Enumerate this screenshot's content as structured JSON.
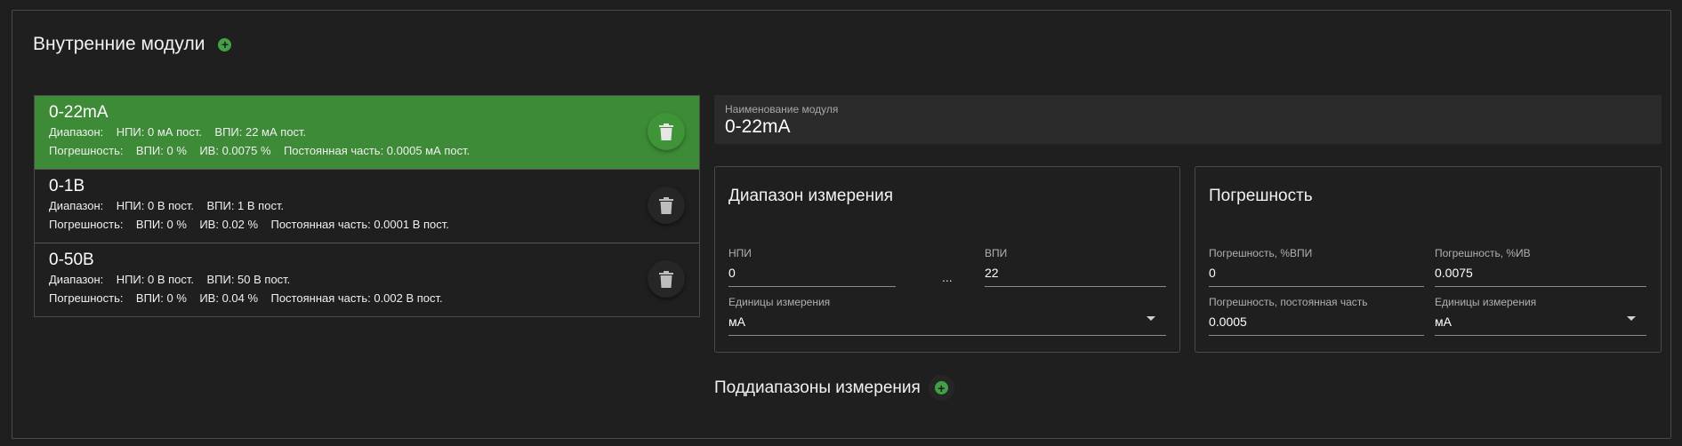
{
  "header": {
    "title": "Внутренние модули"
  },
  "modules": [
    {
      "name": "0-22mA",
      "range_line": "Диапазон:    НПИ: 0 мА пост.    ВПИ: 22 мА пост.",
      "error_line": "Погрешность:    ВПИ: 0 %    ИВ: 0.0075 %    Постоянная часть: 0.0005 мА пост."
    },
    {
      "name": "0-1В",
      "range_line": "Диапазон:    НПИ: 0 В пост.    ВПИ: 1 В пост.",
      "error_line": "Погрешность:    ВПИ: 0 %    ИВ: 0.02 %    Постоянная часть: 0.0001 В пост."
    },
    {
      "name": "0-50В",
      "range_line": "Диапазон:    НПИ: 0 В пост.    ВПИ: 50 В пост.",
      "error_line": "Погрешность:    ВПИ: 0 %    ИВ: 0.04 %    Постоянная часть: 0.002 В пост."
    }
  ],
  "module_name_field": {
    "label": "Наименование модуля",
    "value": "0-22mA"
  },
  "range_card": {
    "title": "Диапазон измерения",
    "npi_label": "НПИ",
    "npi_value": "0",
    "separator": "...",
    "vpi_label": "ВПИ",
    "vpi_value": "22",
    "units_label": "Единицы измерения",
    "units_value": "мА"
  },
  "error_card": {
    "title": "Погрешность",
    "vpi_pct_label": "Погрешность, %ВПИ",
    "vpi_pct_value": "0",
    "iv_pct_label": "Погрешность, %ИВ",
    "iv_pct_value": "0.0075",
    "const_label": "Погрешность, постоянная часть",
    "const_value": "0.0005",
    "units_label": "Единицы измерения",
    "units_value": "мА"
  },
  "subranges": {
    "title": "Поддиапазоны измерения"
  },
  "colors": {
    "accent": "#3d8b37",
    "add_icon": "#43a047",
    "background": "#1e1e1e"
  }
}
